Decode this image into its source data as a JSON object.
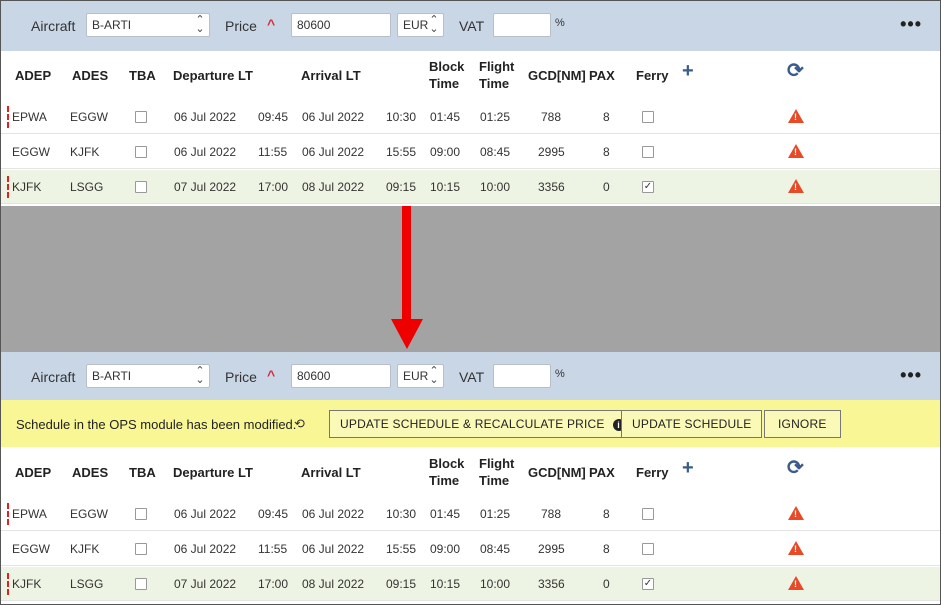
{
  "toolbar": {
    "aircraft_label": "Aircraft",
    "aircraft_value": "B-ARTI",
    "price_label": "Price",
    "price_value": "80600",
    "currency": "EUR",
    "vat_label": "VAT",
    "vat_value": "",
    "percent": "%",
    "more": "•••"
  },
  "headers": {
    "adep": "ADEP",
    "ades": "ADES",
    "tba": "TBA",
    "departure": "Departure LT",
    "arrival": "Arrival LT",
    "block_1": "Block",
    "block_2": "Time",
    "flight_1": "Flight",
    "flight_2": "Time",
    "gcd": "GCD[NM]",
    "pax": "PAX",
    "ferry": "Ferry",
    "add": "+",
    "refresh": "⟳"
  },
  "rows": [
    {
      "adep": "EPWA",
      "ades": "EGGW",
      "dep_date": "06 Jul 2022",
      "dep_time": "09:45",
      "arr_date": "06 Jul 2022",
      "arr_time": "10:30",
      "block": "01:45",
      "flight": "01:25",
      "gcd": "788",
      "pax": "8",
      "ferry_mark": ""
    },
    {
      "adep": "EGGW",
      "ades": "KJFK",
      "dep_date": "06 Jul 2022",
      "dep_time": "11:55",
      "arr_date": "06 Jul 2022",
      "arr_time": "15:55",
      "block": "09:00",
      "flight": "08:45",
      "gcd": "2995",
      "pax": "8",
      "ferry_mark": ""
    },
    {
      "adep": "KJFK",
      "ades": "LSGG",
      "dep_date": "07 Jul 2022",
      "dep_time": "17:00",
      "arr_date": "08 Jul 2022",
      "arr_time": "09:15",
      "block": "10:15",
      "flight": "10:00",
      "gcd": "3356",
      "pax": "0",
      "ferry_mark": "✓"
    }
  ],
  "banner": {
    "message": "Schedule in the OPS module has been modified.",
    "update_recalc": "UPDATE SCHEDULE & RECALCULATE PRICE",
    "update": "UPDATE SCHEDULE",
    "ignore": "IGNORE"
  },
  "colors": {
    "toolbar_bg": "#c9d6e6",
    "banner_bg": "#f8f695",
    "arrow": "#ee0000",
    "warning": "#e84a28",
    "ferry_row_bg": "#eef4e3"
  }
}
